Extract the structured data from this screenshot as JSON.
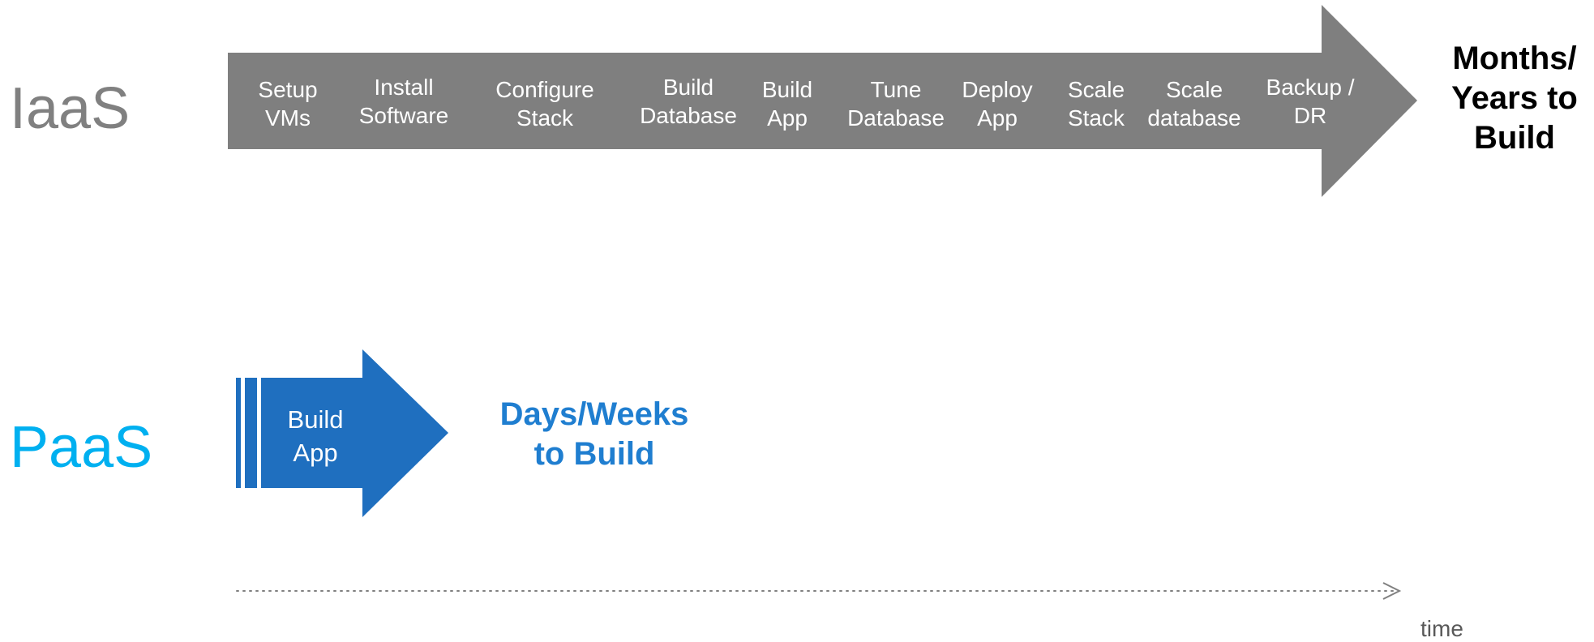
{
  "colors": {
    "iaas_label": "#808080",
    "iaas_arrow": "#7f7f7f",
    "paas_label": "#00b0f0",
    "paas_arrow": "#1f6fbf",
    "iaas_outcome": "#000000",
    "paas_outcome": "#1f7ed0",
    "timeline": "#808080",
    "time_label": "#595959"
  },
  "iaas": {
    "label": "IaaS",
    "steps": [
      [
        "Setup",
        "VMs"
      ],
      [
        "Install",
        "Software"
      ],
      [
        "Configure",
        "Stack"
      ],
      [
        "Build",
        "Database"
      ],
      [
        "Build",
        "App"
      ],
      [
        "Tune",
        "Database"
      ],
      [
        "Deploy",
        "App"
      ],
      [
        "Scale",
        "Stack"
      ],
      [
        "Scale",
        "database"
      ],
      [
        "Backup /",
        "DR"
      ]
    ],
    "outcome": [
      "Months/",
      "Years to",
      "Build"
    ]
  },
  "paas": {
    "label": "PaaS",
    "step": [
      "Build",
      "App"
    ],
    "outcome": [
      "Days/Weeks",
      "to Build"
    ]
  },
  "timeline": {
    "label": "time"
  }
}
